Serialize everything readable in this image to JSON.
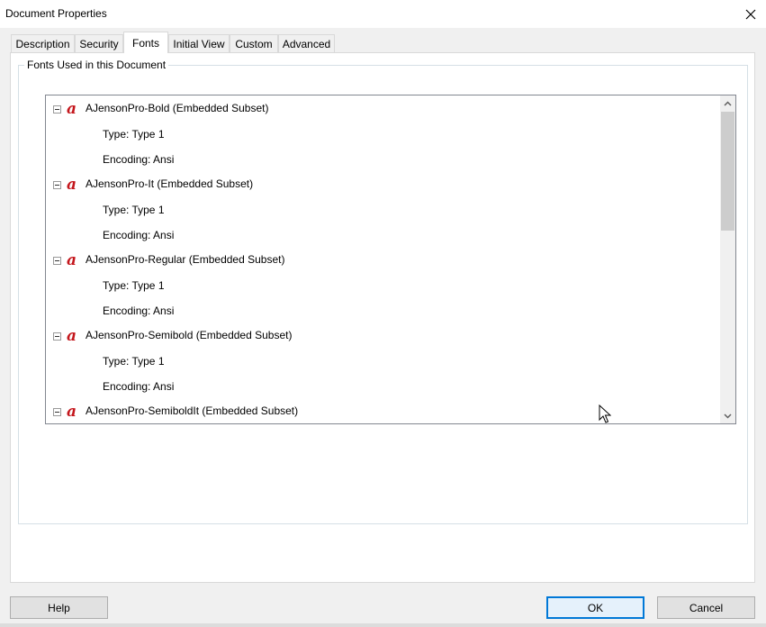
{
  "window": {
    "title": "Document Properties"
  },
  "tabs": [
    {
      "label": "Description",
      "active": false
    },
    {
      "label": "Security",
      "active": false
    },
    {
      "label": "Fonts",
      "active": true
    },
    {
      "label": "Initial View",
      "active": false
    },
    {
      "label": "Custom",
      "active": false
    },
    {
      "label": "Advanced",
      "active": false
    }
  ],
  "fonts_group": {
    "label": "Fonts Used in this Document"
  },
  "fonts": [
    {
      "name": "AJensonPro-Bold (Embedded Subset)",
      "type": "Type: Type 1",
      "encoding": "Encoding: Ansi"
    },
    {
      "name": "AJensonPro-It (Embedded Subset)",
      "type": "Type: Type 1",
      "encoding": "Encoding: Ansi"
    },
    {
      "name": "AJensonPro-Regular (Embedded Subset)",
      "type": "Type: Type 1",
      "encoding": "Encoding: Ansi"
    },
    {
      "name": "AJensonPro-Semibold (Embedded Subset)",
      "type": "Type: Type 1",
      "encoding": "Encoding: Ansi"
    },
    {
      "name": "AJensonPro-SemiboldIt (Embedded Subset)"
    }
  ],
  "buttons": {
    "help": "Help",
    "ok": "OK",
    "cancel": "Cancel"
  },
  "colors": {
    "accent": "#0078d7",
    "font_icon": "#c4161c"
  },
  "icons": {
    "font": "acrobat-font-icon",
    "close": "close-icon",
    "expander": "collapse-minus-icon"
  }
}
